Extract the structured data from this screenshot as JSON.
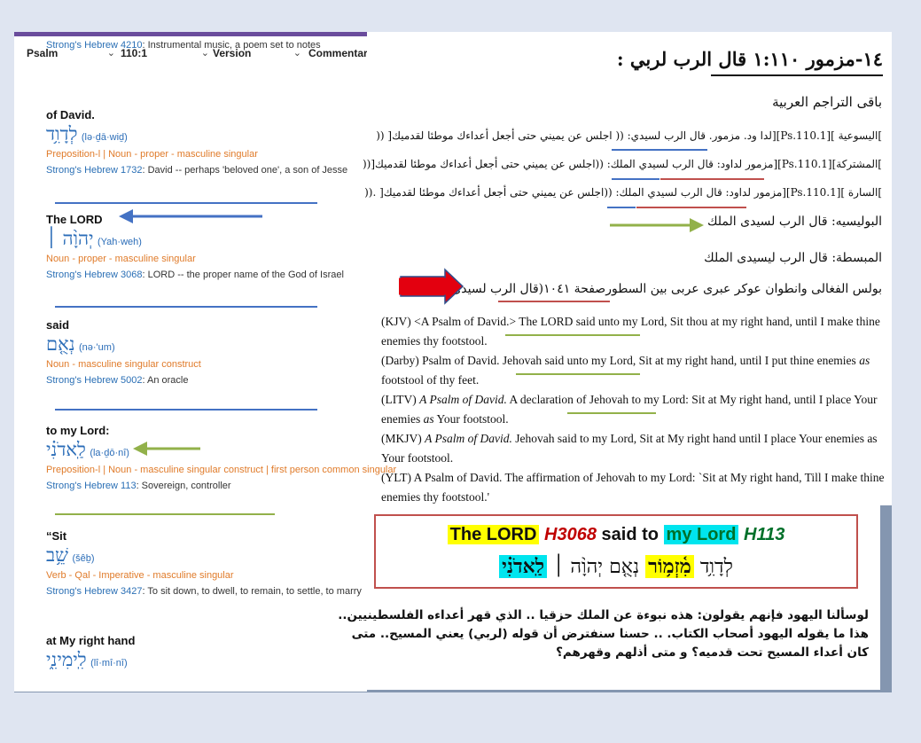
{
  "toolbar": {
    "book": "Psalm",
    "verse": "110:1",
    "version": "Version",
    "commentary": "Commentary"
  },
  "top_strong": {
    "ref": "Strong's Hebrew 4210",
    "desc": ": Instrumental music, a poem set to notes"
  },
  "entries": [
    {
      "gloss": "of David.",
      "hebrew": "לְדָוִ֥ד",
      "translit": "(lə·ḏā·wiḏ)",
      "parse": "Preposition-l | Noun - proper - masculine singular",
      "strong_ref": "Strong's Hebrew 1732",
      "strong_desc": ": David -- perhaps 'beloved one', a son of Jesse"
    },
    {
      "gloss": "The LORD",
      "hebrew": "יְהוָ֨ה ׀",
      "translit": "(Yah·weh)",
      "parse": "Noun - proper - masculine singular",
      "strong_ref": "Strong's Hebrew 3068",
      "strong_desc": ": LORD -- the proper name of the God of Israel"
    },
    {
      "gloss": "said",
      "hebrew": "נְאֻ֤ם",
      "translit": "(nə·'um)",
      "parse": "Noun - masculine singular construct",
      "strong_ref": "Strong's Hebrew 5002",
      "strong_desc": ": An oracle"
    },
    {
      "gloss": "to my Lord:",
      "hebrew": "לַֽאדֹנִ֗י",
      "translit": "(la·ḏō·nî)",
      "parse": "Preposition-l | Noun - masculine singular construct | first person common singular",
      "strong_ref": "Strong's Hebrew 113",
      "strong_desc": ": Sovereign, controller"
    },
    {
      "gloss": "“Sit",
      "hebrew": "שֵׁ֥ב",
      "translit": "(šêḇ)",
      "parse": "Verb - Qal - Imperative - masculine singular",
      "strong_ref": "Strong's Hebrew 3427",
      "strong_desc": ": To sit down, to dwell, to remain, to settle, to marry"
    },
    {
      "gloss": "at My right hand",
      "hebrew": "לִֽימִינִ֑י",
      "translit": "(lî·mî·nî)"
    }
  ],
  "heading": "١٤-مزمور ١:١١٠ قال الرب لربي :",
  "arabic": {
    "remaining": "باقى التراجم العربية",
    "t1": "]اليسوعية ][Ps.110.1][لدا ود. مزمور. قال الرب لسيدي: (( اجلس عن يميني حتى أجعل أعداءك موطئا لقدميك[ ((",
    "t2": "]المشتركة][Ps.110.1][مزمور لداود: قال الرب لسيدي الملك: ((اجلس عن يميني حتى أجعل أعداءك موطئا لقدميك[((",
    "t3": "]السارة ][Ps.110.1][مزمور لداود: قال الرب لسيدي الملك: ((اجلس عن يميني حتى أجعل أعداءك موطئا لقدميك[ .((",
    "t4": "البوليسيه: قال الرب لسيدى الملك",
    "t5": "المبسطة: قال الرب ليسيدى الملك",
    "t6": "بولس الفغالى وانطوان عوكر عبرى عربى بين السطورصفحة ١٠٤١(قال الرب لسيدى الملك )"
  },
  "english": {
    "kjv_prefix": "(KJV)  <A Psalm of David.> ",
    "kjv_rest": "The LORD said unto my Lord, Sit thou at my right hand, until I make thine enemies thy footstool.",
    "darby_prefix": "(Darby)  Psalm of David. ",
    "darby_rest": "Jehovah said unto my Lord, Sit at my right hand, until I put thine enemies ",
    "darby_italic": "as",
    "darby_end": " footstool of thy feet.",
    "litv_prefix": "(LITV)  ",
    "litv_italic": "A Psalm of David.",
    "litv_rest": " A declaration of Jehovah to my Lord: Sit at My right hand, until I place Your enemies ",
    "litv_italic2": "as",
    "litv_end": " Your footstool.",
    "mkjv_prefix": "(MKJV)  ",
    "mkjv_italic": "A Psalm of David.",
    "mkjv_rest": " Jehovah said to my Lord, Sit at My right hand until I place Your enemies as Your footstool.",
    "ylt_prefix": "(YLT)  ",
    "ylt_rest": "A Psalm of David. The affirmation of Jehovah to my Lord: `Sit at My right hand, Till I make thine enemies thy footstool.'"
  },
  "box": {
    "the_lord": "The LORD",
    "h3068": "H3068",
    "said_to": "said to",
    "my_lord": "my Lord",
    "h113": "H113",
    "heb_david": "לְדָוִ֥ד",
    "heb_mizmor": "מִ֫זְמ֥וֹר",
    "heb_neum": "נְאֻ֤ם",
    "heb_yhwh": "יְהוָ֨ה ׀",
    "heb_ladoni": "לַֽאדֹנִ֗י"
  },
  "bottom_text": "لوسألنا اليهود فإنهم يقولون: هذه نبوءة عن الملك حزقيا .. الذي قهر أعداءه الفلسطينيين.. هذا ما يقوله اليهود أصحاب الكتاب. .. حسنا سنفترض أن قوله (لربي) يعني المسيح.. متى كان أعداء المسيح تحت قدميه؟ و متى أذلهم وقهرهم؟",
  "colors": {
    "arrow_blue": "#4472c4",
    "arrow_green": "#92b14a",
    "arrow_red": "#e3000f",
    "underline_red": "#c0504d",
    "box_border": "#c0504d",
    "highlight_yellow": "#ffff00",
    "highlight_cyan": "#00e5ee"
  }
}
